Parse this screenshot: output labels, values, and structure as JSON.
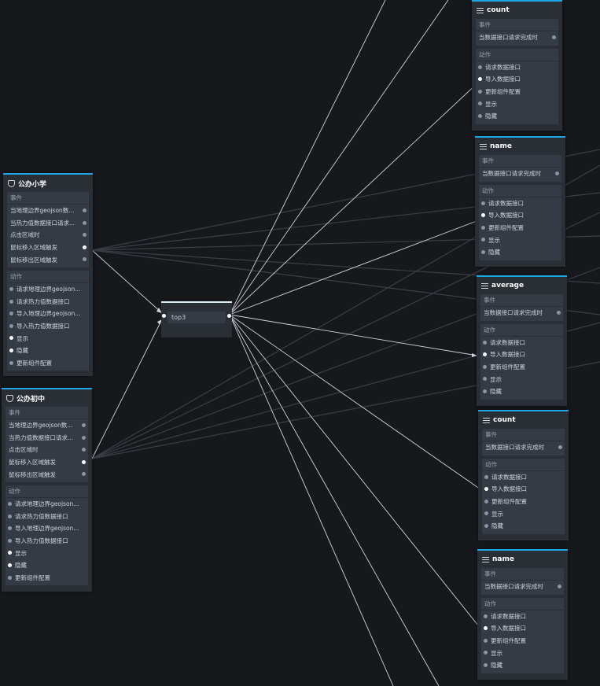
{
  "edges_label": "flow editor",
  "left_nodes": [
    {
      "id": "primary",
      "title": "公办小学",
      "icon": "shield-icon",
      "events_label": "事件",
      "events": [
        "当地理边界geojson数...",
        "当热力值数据接口请求...",
        "点击区域时",
        "鼠标移入区域触发",
        "鼠标移出区域触发"
      ],
      "events_active": [
        false,
        false,
        false,
        true,
        false
      ],
      "actions_label": "动作",
      "actions": [
        "请求地理边界geojson...",
        "请求热力值数据接口",
        "导入地理边界geojson...",
        "导入热力值数据接口",
        "显示",
        "隐藏",
        "更新组件配置"
      ],
      "actions_active": [
        false,
        false,
        false,
        false,
        true,
        true,
        false
      ]
    },
    {
      "id": "middle",
      "title": "公办初中",
      "icon": "shield-icon",
      "events_label": "事件",
      "events": [
        "当地理边界geojson数...",
        "当热力值数据接口请求...",
        "点击区域时",
        "鼠标移入区域触发",
        "鼠标移出区域触发"
      ],
      "events_active": [
        false,
        false,
        false,
        true,
        false
      ],
      "actions_label": "动作",
      "actions": [
        "请求地理边界geojson...",
        "请求热力值数据接口",
        "导入地理边界geojson...",
        "导入热力值数据接口",
        "显示",
        "隐藏",
        "更新组件配置"
      ],
      "actions_active": [
        false,
        false,
        false,
        false,
        true,
        true,
        false
      ]
    }
  ],
  "center_node": {
    "label": "top3"
  },
  "right_nodes": [
    {
      "title": "count",
      "events_label": "事件",
      "event": "当数据接口请求完成时",
      "actions_label": "动作",
      "actions": [
        "请求数据接口",
        "导入数据接口",
        "更新组件配置",
        "显示",
        "隐藏"
      ],
      "actions_active": [
        false,
        true,
        false,
        false,
        false
      ]
    },
    {
      "title": "name",
      "events_label": "事件",
      "event": "当数据接口请求完成时",
      "actions_label": "动作",
      "actions": [
        "请求数据接口",
        "导入数据接口",
        "更新组件配置",
        "显示",
        "隐藏"
      ],
      "actions_active": [
        false,
        true,
        false,
        false,
        false
      ]
    },
    {
      "title": "average",
      "events_label": "事件",
      "event": "当数据接口请求完成时",
      "actions_label": "动作",
      "actions": [
        "请求数据接口",
        "导入数据接口",
        "更新组件配置",
        "显示",
        "隐藏"
      ],
      "actions_active": [
        false,
        true,
        false,
        false,
        false
      ]
    },
    {
      "title": "count",
      "events_label": "事件",
      "event": "当数据接口请求完成时",
      "actions_label": "动作",
      "actions": [
        "请求数据接口",
        "导入数据接口",
        "更新组件配置",
        "显示",
        "隐藏"
      ],
      "actions_active": [
        false,
        true,
        false,
        false,
        false
      ]
    },
    {
      "title": "name",
      "events_label": "事件",
      "event": "当数据接口请求完成时",
      "actions_label": "动作",
      "actions": [
        "请求数据接口",
        "导入数据接口",
        "更新组件配置",
        "显示",
        "隐藏"
      ],
      "actions_active": [
        false,
        true,
        false,
        false,
        false
      ]
    }
  ],
  "colors": {
    "background": "#16181c",
    "node": "#2a2e35",
    "section": "#353b44",
    "accent": "#1ea6e6",
    "wire": "#d0d4da",
    "wire_dim": "#3a3f47"
  }
}
